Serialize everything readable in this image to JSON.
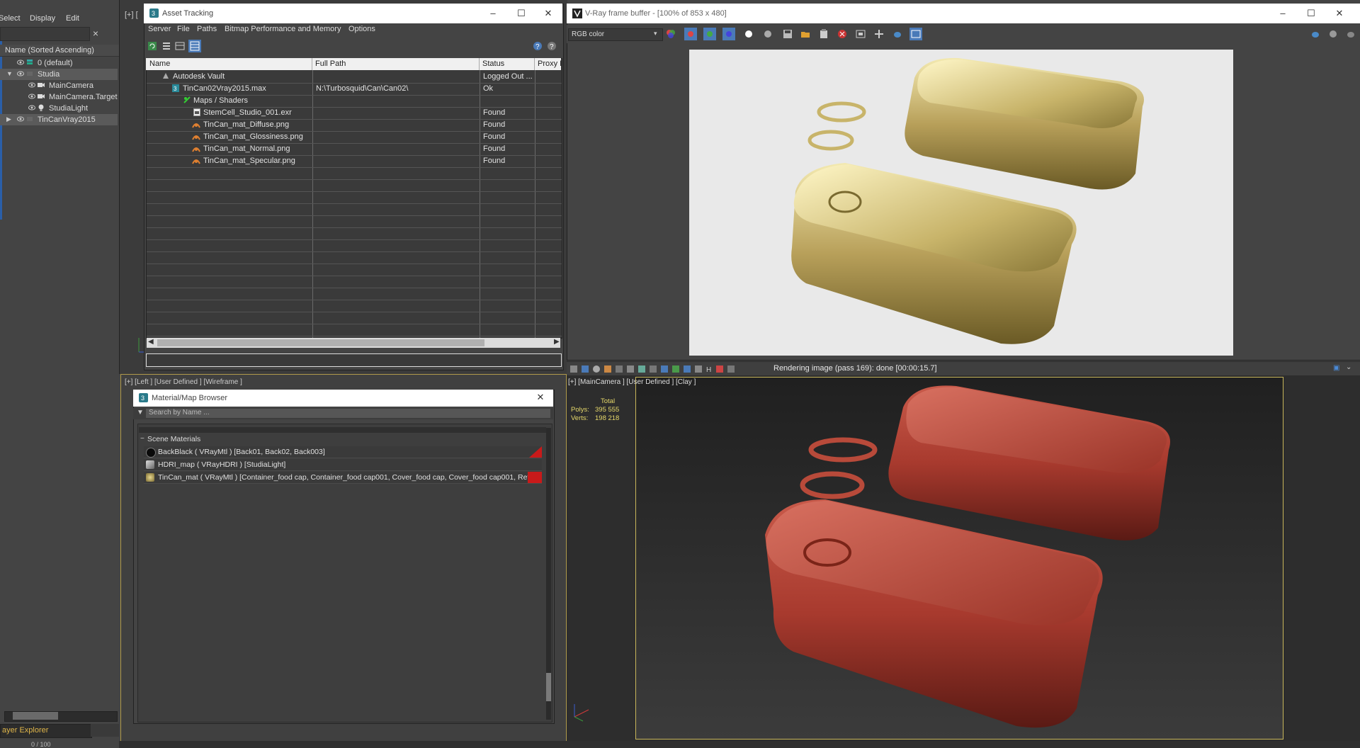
{
  "scene_explorer": {
    "menu": [
      "Select",
      "Display",
      "Edit"
    ],
    "header": "Name (Sorted Ascending)",
    "rows": [
      {
        "label": "0 (default)"
      },
      {
        "label": "Studia"
      },
      {
        "label": "MainCamera"
      },
      {
        "label": "MainCamera.Target"
      },
      {
        "label": "StudiaLight"
      },
      {
        "label": "TinCanVray2015"
      }
    ],
    "footer": "ayer Explorer",
    "frame_readout": "0 / 100"
  },
  "viewport_top_left": {
    "label": "[+] ["
  },
  "viewport_left": {
    "label": "[+] [Left ] [User Defined ] [Wireframe ]"
  },
  "asset_tracking": {
    "title": "Asset Tracking",
    "menu": [
      "Server",
      "File",
      "Paths",
      "Bitmap Performance and Memory",
      "Options"
    ],
    "columns": [
      "Name",
      "Full Path",
      "Status",
      "Proxy R"
    ],
    "rows": [
      {
        "name": "Autodesk Vault",
        "path": "",
        "status": "Logged Out ..."
      },
      {
        "name": "TinCan02Vray2015.max",
        "path": "N:\\Turbosquid\\Can\\Can02\\",
        "status": "Ok"
      },
      {
        "name": "Maps / Shaders",
        "path": "",
        "status": ""
      },
      {
        "name": "StemCell_Studio_001.exr",
        "path": "",
        "status": "Found"
      },
      {
        "name": "TinCan_mat_Diffuse.png",
        "path": "",
        "status": "Found"
      },
      {
        "name": "TinCan_mat_Glossiness.png",
        "path": "",
        "status": "Found"
      },
      {
        "name": "TinCan_mat_Normal.png",
        "path": "",
        "status": "Found"
      },
      {
        "name": "TinCan_mat_Specular.png",
        "path": "",
        "status": "Found"
      }
    ]
  },
  "material_browser": {
    "title": "Material/Map Browser",
    "search_placeholder": "Search by Name ...",
    "group": "Scene Materials",
    "materials": [
      {
        "label": "BackBlack  ( VRayMtl ) [Back01, Back02, Back003]",
        "swatch": "#0a0a0a"
      },
      {
        "label": "HDRI_map  ( VRayHDRI ) [StudiaLight]",
        "swatch": "#9a9a9a"
      },
      {
        "label": "TinCan_mat  ( VRayMtl ) [Container_food cap, Container_food cap001, Cover_food cap, Cover_food cap001, Retaine...",
        "swatch": "#b8a060"
      }
    ]
  },
  "vfb": {
    "title": "V-Ray frame buffer - [100% of 853 x 480]",
    "channel": "RGB color",
    "status": "Rendering image (pass 169): done [00:00:15.7]"
  },
  "perspective": {
    "label": "[+] [MainCamera ] [User Defined ] [Clay ]",
    "stats_header": "Total",
    "polys_label": "Polys:",
    "polys": "395 555",
    "verts_label": "Verts:",
    "verts": "198 218"
  },
  "colors": {
    "accent_blue": "#2a5fa8",
    "clay_red": "#a83a2e",
    "gold": "#b8a060",
    "found_icon": "#e08030"
  }
}
